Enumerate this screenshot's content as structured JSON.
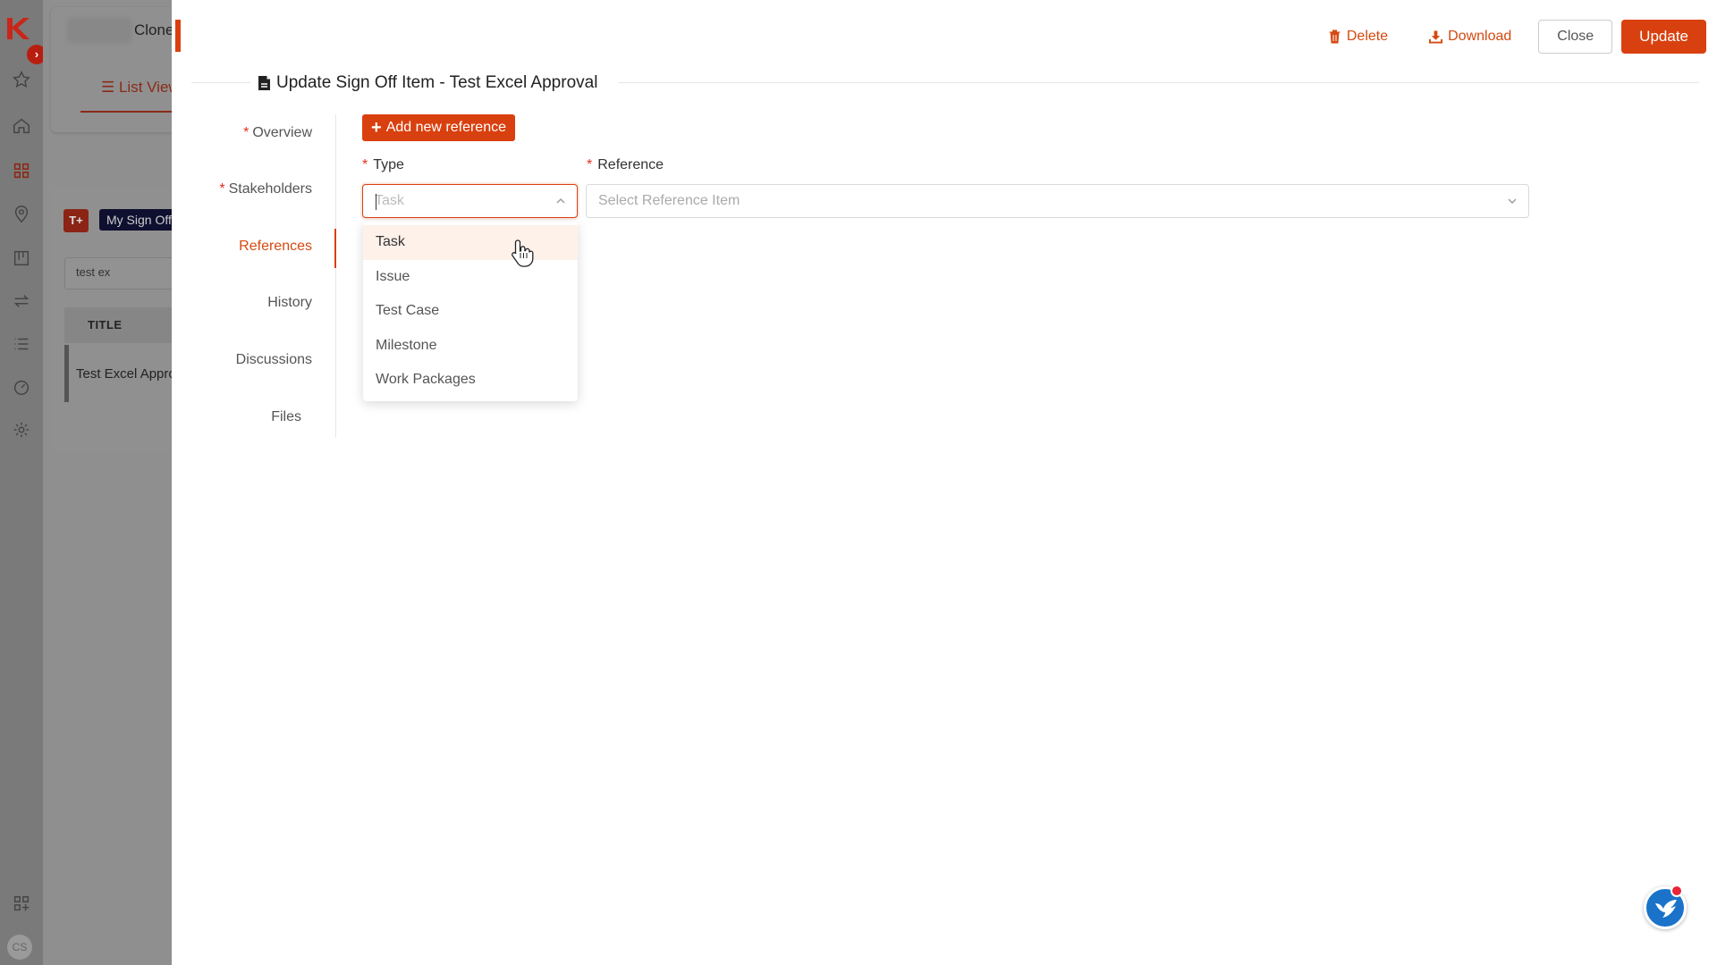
{
  "background": {
    "clone_text": "Clone",
    "list_view": "List View",
    "my_sign_off": "My Sign Off",
    "badge_text": "T+",
    "search_value": "test ex",
    "col_title": "TITLE",
    "row_title": "Test Excel Approval",
    "avatar": "CS"
  },
  "header": {
    "delete_label": "Delete",
    "download_label": "Download",
    "close_label": "Close",
    "update_label": "Update",
    "title": "Update Sign Off Item - Test Excel Approval"
  },
  "tabs": [
    {
      "label": "Overview",
      "required": true
    },
    {
      "label": "Stakeholders",
      "required": true
    },
    {
      "label": "References",
      "required": false,
      "active": true
    },
    {
      "label": "History",
      "required": false
    },
    {
      "label": "Discussions",
      "required": false
    },
    {
      "label": "Files",
      "required": false
    }
  ],
  "references": {
    "add_label": "Add new reference",
    "type_label": "Type",
    "type_placeholder": "Task",
    "reference_label": "Reference",
    "reference_placeholder": "Select Reference Item",
    "required_mark": "*"
  },
  "dropdown": {
    "options": [
      "Task",
      "Issue",
      "Test Case",
      "Milestone",
      "Work Packages"
    ],
    "highlighted": "Task"
  },
  "colors": {
    "accent": "#d9400f",
    "required": "#e0301e"
  }
}
